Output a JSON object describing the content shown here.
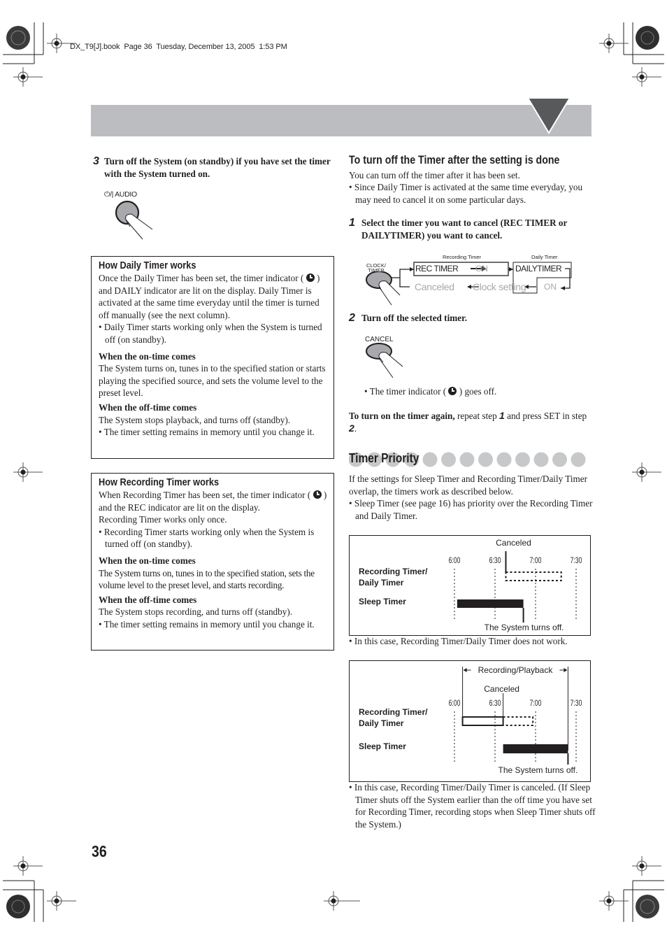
{
  "print_header": "DX_T9[J].book  Page 36  Tuesday, December 13, 2005  1:53 PM",
  "page_number": "36",
  "colors": {
    "banner": "#bcbdc0",
    "banner_triangle": "#58595b",
    "text": "#231f20",
    "inactive": "#a8a9ad",
    "dot": "#c7c8ca"
  },
  "left": {
    "step3": {
      "num": "3",
      "text": "Turn off the System (on standby) if you have set the timer with the System turned on.",
      "button_label": "⏻/| AUDIO"
    },
    "daily_box": {
      "title": "How Daily Timer works",
      "intro_a": "Once the Daily Timer has been set, the timer indicator (",
      "intro_b": ") and DAILY indicator are lit on the display. Daily Timer is activated at the same time everyday until the timer is turned off manually (see the next column).",
      "bullet1": "• Daily Timer starts working only when the System is turned off (on standby).",
      "on_head": "When the on-time comes",
      "on_text": "The System turns on, tunes in to the specified station or starts playing the specified source, and sets the volume level to the preset level.",
      "off_head": "When the off-time comes",
      "off_text": "The System stops playback, and turns off (standby).",
      "bullet2": "• The timer setting remains in memory until you change it."
    },
    "rec_box": {
      "title": "How Recording Timer works",
      "intro_a": "When Recording Timer has been set, the timer indicator (",
      "intro_b": ") and the REC indicator are lit on the display.",
      "intro_c": "Recording Timer works only once.",
      "bullet1": "• Recording Timer starts working only when the System is turned off (on standby).",
      "on_head": "When the on-time comes",
      "on_text": "The System turns on, tunes in to the specified station, sets the volume level to the preset level, and starts recording.",
      "off_head": "When the off-time comes",
      "off_text": "The System stops recording, and turns off (standby).",
      "bullet2": "• The timer setting remains in memory until you change it."
    }
  },
  "right": {
    "turnoff": {
      "heading": "To turn off the Timer after the setting is done",
      "intro": "You can turn off the timer after it has been set.",
      "bullet": "• Since Daily Timer is activated at the same time everyday, you may need to cancel it on some particular days.",
      "step1_num": "1",
      "step1_text": "Select the timer you want to cancel (REC TIMER or DAILYTIMER) you want to cancel.",
      "flow": {
        "button_label": "CLOCK/\nTIMER",
        "rec_caption": "Recording Timer",
        "daily_caption": "Daily Timer",
        "rec_timer": "REC TIMER",
        "on1": "ON",
        "dailytimer": "DAILYTIMER",
        "on2": "ON",
        "clock_setting": "Clock setting",
        "canceled": "Canceled"
      },
      "step2_num": "2",
      "step2_text": "Turn off the selected timer.",
      "cancel_label": "CANCEL",
      "indicator_a": "• The timer indicator (",
      "indicator_b": ") goes off.",
      "again_bold": "To turn on the timer again,",
      "again_a": " repeat step ",
      "again_num1": "1",
      "again_b": " and press SET in step ",
      "again_num2": "2",
      "again_c": "."
    },
    "priority": {
      "heading": "Timer Priority",
      "intro": "If the settings for Sleep Timer and Recording Timer/Daily Timer overlap, the timers work as described below.",
      "bullet": "• Sleep Timer (see page 16) has priority over the Recording Timer and Daily Timer.",
      "case1_note": "• In this case, Recording Timer/Daily Timer does not work.",
      "case2_note": "• In this case, Recording Timer/Daily Timer is canceled. (If Sleep Timer shuts off the System earlier than the off time you have set for Recording Timer, recording stops when Sleep Timer shuts off the System.)"
    }
  },
  "chart_data": [
    {
      "type": "timeline",
      "title": "",
      "row_labels": [
        "Recording Timer/",
        "Daily Timer",
        "Sleep Timer"
      ],
      "x_ticks": [
        "6:00",
        "6:30",
        "7:00",
        "7:30"
      ],
      "x_tick_minutes": [
        0,
        30,
        60,
        90
      ],
      "annotations": {
        "top": "Canceled",
        "bottom": "The System turns off."
      },
      "series": [
        {
          "name": "Recording Timer/Daily Timer",
          "start_min": 38,
          "end_min": 79,
          "style": "dotted (canceled)"
        },
        {
          "name": "Sleep Timer",
          "start_min": 2,
          "end_min": 51,
          "style": "solid"
        }
      ],
      "canceled_at_min": 38,
      "system_off_at_min": 51
    },
    {
      "type": "timeline",
      "title": "",
      "row_labels": [
        "Recording Timer/",
        "Daily Timer",
        "Sleep Timer"
      ],
      "x_ticks": [
        "6:00",
        "6:30",
        "7:00",
        "7:30"
      ],
      "x_tick_minutes": [
        0,
        30,
        60,
        90
      ],
      "annotations": {
        "span": "Recording/Playback",
        "top": "Canceled",
        "bottom": "The System turns off."
      },
      "series": [
        {
          "name": "Recording Timer/Daily Timer (active)",
          "start_min": 6,
          "end_min": 36,
          "style": "outline"
        },
        {
          "name": "Recording Timer/Daily Timer (canceled)",
          "start_min": 36,
          "end_min": 58,
          "style": "dotted"
        },
        {
          "name": "Sleep Timer",
          "start_min": 36,
          "end_min": 84,
          "style": "solid"
        }
      ],
      "canceled_at_min": 36,
      "system_off_at_min": 84,
      "recording_playback_span_min": [
        6,
        84
      ]
    }
  ]
}
